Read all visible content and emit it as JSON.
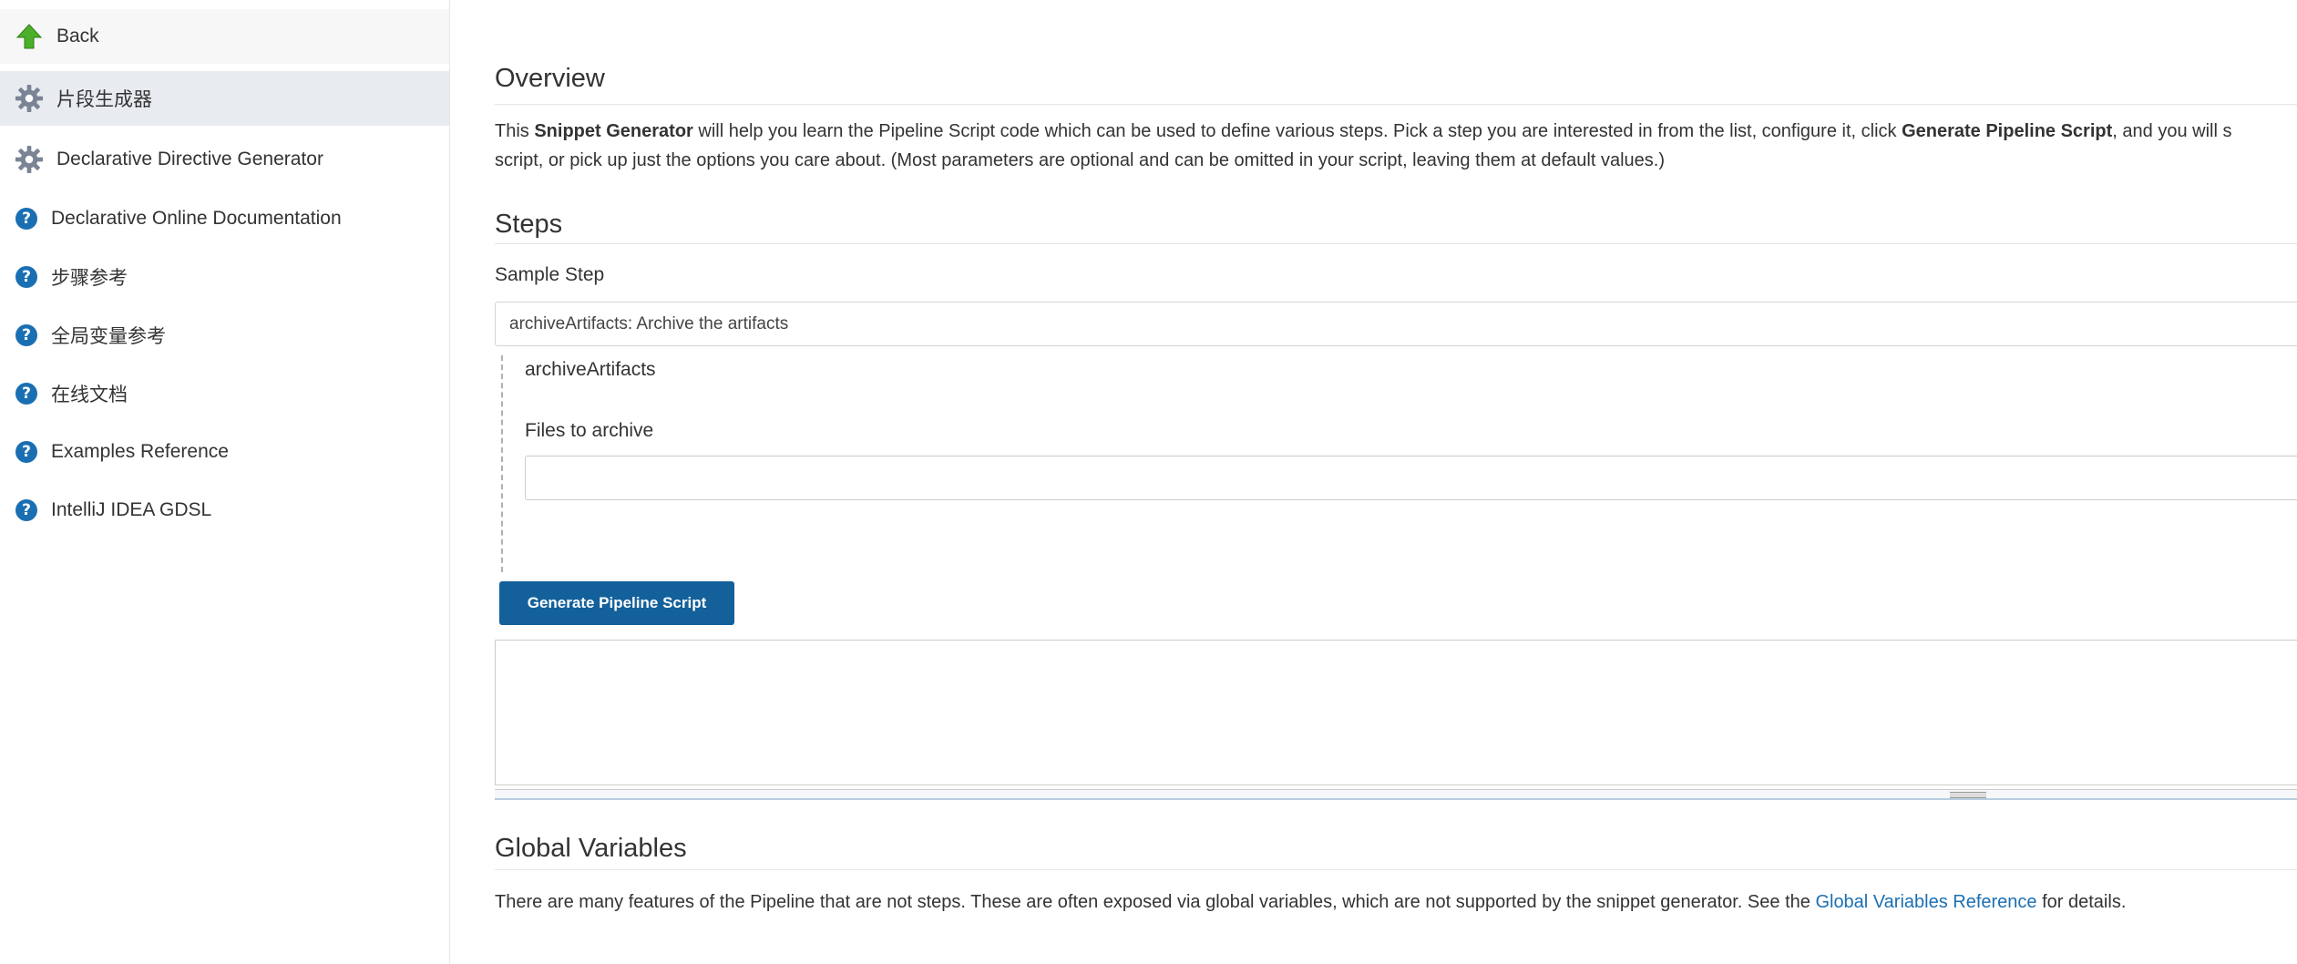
{
  "sidebar": {
    "back_label": "Back",
    "items": [
      {
        "label": "片段生成器",
        "icon": "gear-icon",
        "active": true
      },
      {
        "label": "Declarative Directive Generator",
        "icon": "gear-icon",
        "active": false
      },
      {
        "label": "Declarative Online Documentation",
        "icon": "help-icon",
        "active": false
      },
      {
        "label": "步骤参考",
        "icon": "help-icon",
        "active": false
      },
      {
        "label": "全局变量参考",
        "icon": "help-icon",
        "active": false
      },
      {
        "label": "在线文档",
        "icon": "help-icon",
        "active": false
      },
      {
        "label": "Examples Reference",
        "icon": "help-icon",
        "active": false
      },
      {
        "label": "IntelliJ IDEA GDSL",
        "icon": "help-icon",
        "active": false
      }
    ]
  },
  "overview": {
    "title": "Overview",
    "line1_pre": "This ",
    "line1_bold1": "Snippet Generator",
    "line1_mid": " will help you learn the Pipeline Script code which can be used to define various steps. Pick a step you are interested in from the list, configure it, click ",
    "line1_bold2": "Generate Pipeline Script",
    "line1_post": ", and you will s",
    "line2": "script, or pick up just the options you care about. (Most parameters are optional and can be omitted in your script, leaving them at default values.)"
  },
  "steps": {
    "title": "Steps",
    "sample_step_label": "Sample Step",
    "sample_step_value": "archiveArtifacts: Archive the artifacts",
    "step_name": "archiveArtifacts",
    "files_label": "Files to archive",
    "files_value": "",
    "generate_button": "Generate Pipeline Script",
    "output_value": ""
  },
  "global_variables": {
    "title": "Global Variables",
    "text_pre": "There are many features of the Pipeline that are not steps. These are often exposed via global variables, which are not supported by the snippet generator. See the ",
    "link_text": "Global Variables Reference",
    "text_post": " for details."
  },
  "colors": {
    "accent": "#13609b",
    "link": "#1a6fb3",
    "back_arrow": "#4caf2a"
  }
}
